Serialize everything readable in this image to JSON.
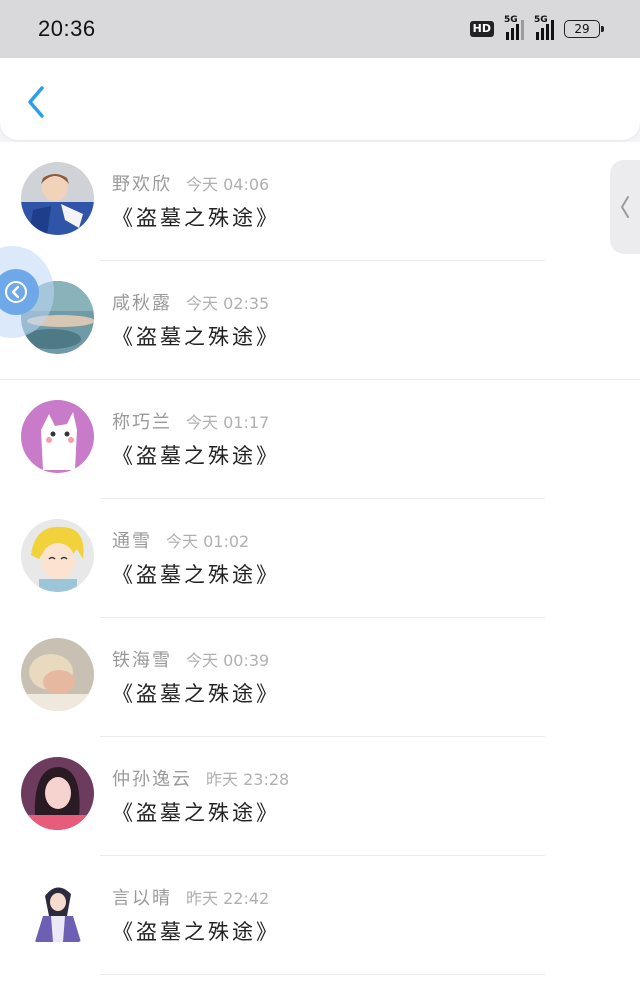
{
  "status_bar": {
    "time": "20:36",
    "hd_label": "HD",
    "signal1_label": "5G",
    "signal2_label": "5G",
    "battery_level": "29"
  },
  "nav": {
    "back_icon": "chevron-left-icon"
  },
  "colors": {
    "accent": "#2aa0e8",
    "name_gray": "#9a9a9a",
    "message_dark": "#222222"
  },
  "messages": [
    {
      "name": "野欢欣",
      "time": "今天 04:06",
      "text": "《盗墓之殊途》"
    },
    {
      "name": "咸秋露",
      "time": "今天 02:35",
      "text": "《盗墓之殊途》"
    },
    {
      "name": "称巧兰",
      "time": "今天 01:17",
      "text": "《盗墓之殊途》"
    },
    {
      "name": "通雪",
      "time": "今天 01:02",
      "text": "《盗墓之殊途》"
    },
    {
      "name": "铁海雪",
      "time": "今天 00:39",
      "text": "《盗墓之殊途》"
    },
    {
      "name": "仲孙逸云",
      "time": "昨天 23:28",
      "text": "《盗墓之殊途》"
    },
    {
      "name": "言以晴",
      "time": "昨天 22:42",
      "text": "《盗墓之殊途》"
    }
  ]
}
